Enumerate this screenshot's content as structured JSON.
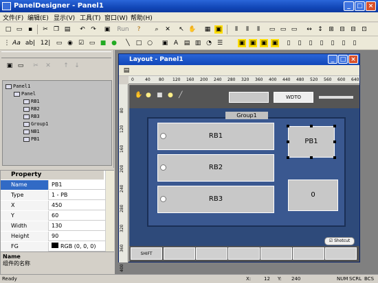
{
  "app": {
    "title": "PanelDesigner - Panel1"
  },
  "menu": [
    "文件(F)",
    "编辑(E)",
    "显示(V)",
    "工具(T)",
    "窗口(W)",
    "帮助(H)"
  ],
  "toolbar": {
    "font_label": "Aa",
    "ab_label": "ab|",
    "num_label": "12|",
    "run_label": "Run"
  },
  "tree": [
    {
      "label": "Panel1",
      "level": 0
    },
    {
      "label": "Panel",
      "level": 1
    },
    {
      "label": "RB1",
      "level": 2
    },
    {
      "label": "RB2",
      "level": 2
    },
    {
      "label": "RB3",
      "level": 2
    },
    {
      "label": "Group1",
      "level": 2
    },
    {
      "label": "NB1",
      "level": 2
    },
    {
      "label": "PB1",
      "level": 2
    }
  ],
  "props": {
    "header": "Property",
    "rows": [
      {
        "k": "Name",
        "v": "PB1"
      },
      {
        "k": "Type",
        "v": "1 - PB"
      },
      {
        "k": "X",
        "v": "450"
      },
      {
        "k": "Y",
        "v": "60"
      },
      {
        "k": "Width",
        "v": "130"
      },
      {
        "k": "Height",
        "v": "90"
      },
      {
        "k": "FG",
        "v": "RGB (0, 0, 0)"
      }
    ],
    "desc_title": "Name",
    "desc_text": "组件的名称"
  },
  "child": {
    "title": "Layout - Panel1"
  },
  "ruler_top": [
    "0",
    "40",
    "80",
    "120",
    "160",
    "200",
    "240",
    "280",
    "320",
    "360",
    "400",
    "440",
    "480",
    "520",
    "560",
    "600",
    "640"
  ],
  "ruler_left": [
    "80",
    "120",
    "160",
    "200",
    "240",
    "280",
    "320",
    "360",
    "400"
  ],
  "canvas": {
    "wdto": "WDTO",
    "group_label": "Group1",
    "rb1": "RB1",
    "rb2": "RB2",
    "rb3": "RB3",
    "pb1": "PB1",
    "nb1": "0",
    "shotcut": "Shotcut",
    "shift": "SHIFT"
  },
  "status": {
    "ready": "Ready",
    "x_label": "X:",
    "x_val": "12",
    "y_label": "Y:",
    "y_val": "240",
    "num": "NUM",
    "scrl": "SCRL",
    "bcs": "BCS"
  }
}
